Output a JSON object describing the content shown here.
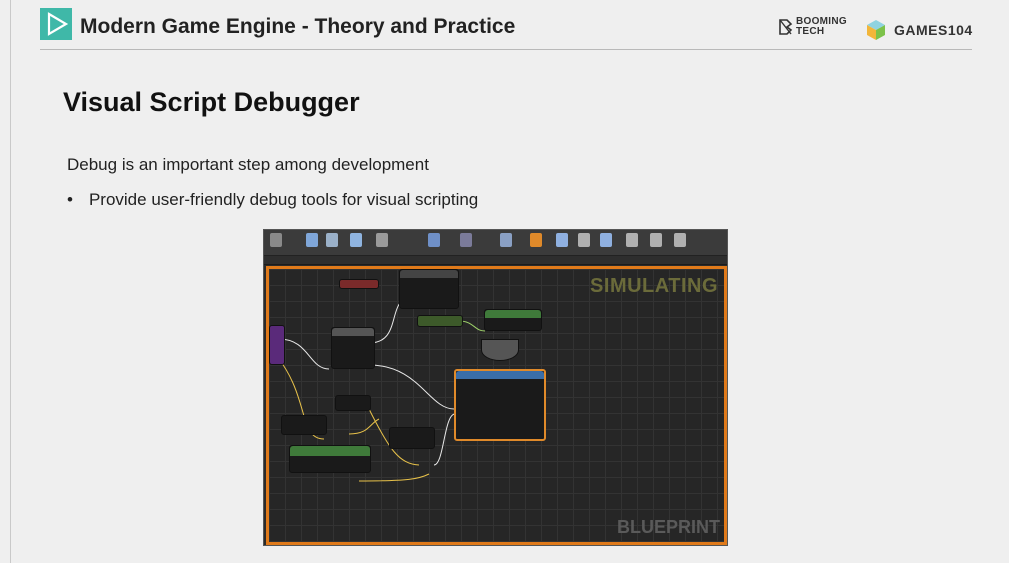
{
  "header": {
    "course_title": "Modern Game Engine - Theory and Practice",
    "booming_line1": "BOOMING",
    "booming_line2": "TECH",
    "brand": "GAMES104",
    "colors": {
      "logo": "#3fb8a8",
      "rule": "#b9b9b9"
    }
  },
  "slide": {
    "title": "Visual Script Debugger",
    "body": "Debug is an important step among development",
    "bullet_mark": "•",
    "bullet_text": "Provide user-friendly debug tools for visual scripting"
  },
  "screenshot": {
    "overlay_simulating": "SIMULATING",
    "overlay_blueprint": "BLUEPRINT",
    "highlight_color": "#e07a1a"
  }
}
